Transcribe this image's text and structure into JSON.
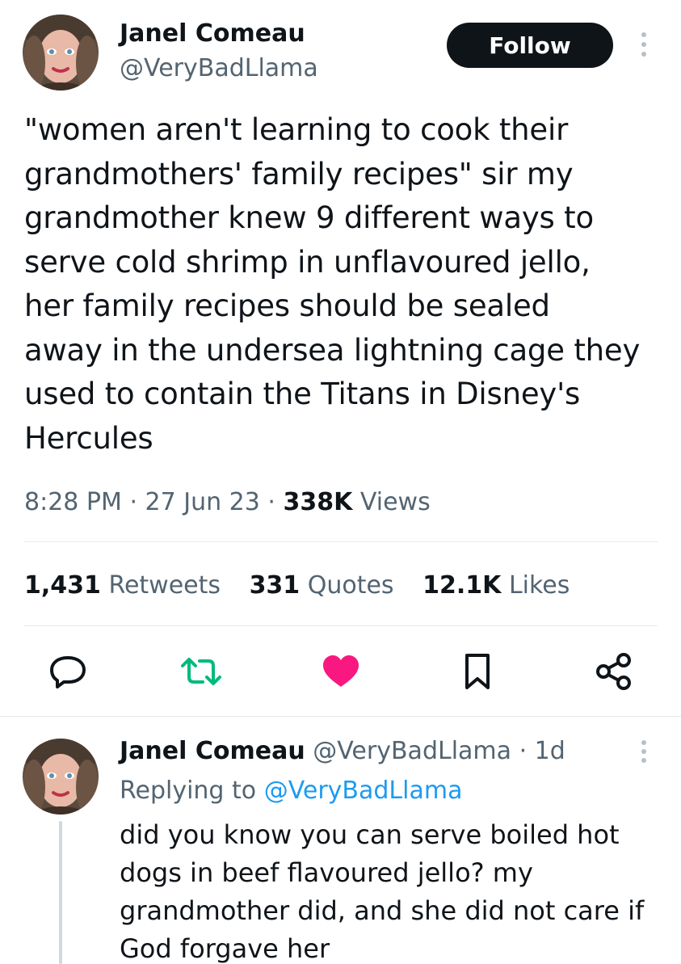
{
  "tweet": {
    "author_name": "Janel Comeau",
    "author_handle": "@VeryBadLlama",
    "follow_label": "Follow",
    "text_lines": [
      "\"women aren't learning to cook their",
      "grandmothers' family recipes\" sir my",
      "grandmother knew 9 different ways to",
      "serve cold shrimp in unflavoured jello,",
      "her family recipes should be sealed",
      "away in the undersea lightning cage they",
      "used to contain the Titans in Disney's",
      "Hercules"
    ],
    "time": "8:28 PM",
    "date": "27 Jun 23",
    "views_count": "338K",
    "views_label": "Views",
    "separator": "·",
    "retweets_count": "1,431",
    "retweets_label": "Retweets",
    "quotes_count": "331",
    "quotes_label": "Quotes",
    "likes_count": "12.1K",
    "likes_label": "Likes",
    "actions": [
      {
        "name": "reply-icon"
      },
      {
        "name": "retweet-icon"
      },
      {
        "name": "like-icon",
        "color": "#f91880"
      },
      {
        "name": "bookmark-icon"
      },
      {
        "name": "share-icon"
      }
    ]
  },
  "reply": {
    "author_name": "Janel Comeau",
    "author_handle": "@VeryBadLlama",
    "age": "1d",
    "separator": "·",
    "replying_prefix": "Replying to",
    "replying_handle": "@VeryBadLlama",
    "text_lines": [
      "did you know you can serve boiled hot",
      "dogs in beef flavoured jello? my",
      "grandmother did, and she did not care if",
      "God forgave her"
    ]
  },
  "colors": {
    "text": "#0f1419",
    "muted": "#536471",
    "link": "#1d9bf0",
    "retweet_green": "#00ba7c",
    "like_pink": "#f91880",
    "divider": "#e6e9eb"
  }
}
